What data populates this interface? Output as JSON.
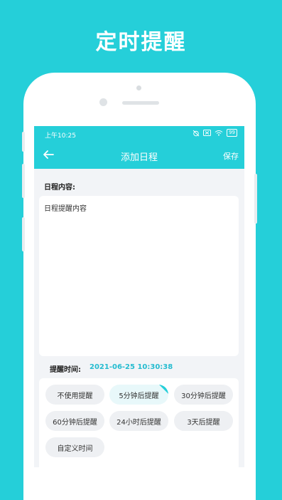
{
  "promo": {
    "title": "定时提醒"
  },
  "status_bar": {
    "time": "上午10:25",
    "battery": "99"
  },
  "app_bar": {
    "title": "添加日程",
    "save_label": "保存"
  },
  "content": {
    "label": "日程内容:",
    "value": "日程提醒内容"
  },
  "reminder": {
    "label": "提醒时间:",
    "value": "2021-06-25 10:30:38",
    "options": [
      "不使用提醒",
      "5分钟后提醒",
      "30分钟后提醒",
      "60分钟后提醒",
      "24小时后提醒",
      "3天后提醒",
      "自定义时间"
    ],
    "selected": "5分钟后提醒"
  },
  "colors": {
    "accent": "#25cfd9",
    "date_text": "#25bcd0"
  }
}
